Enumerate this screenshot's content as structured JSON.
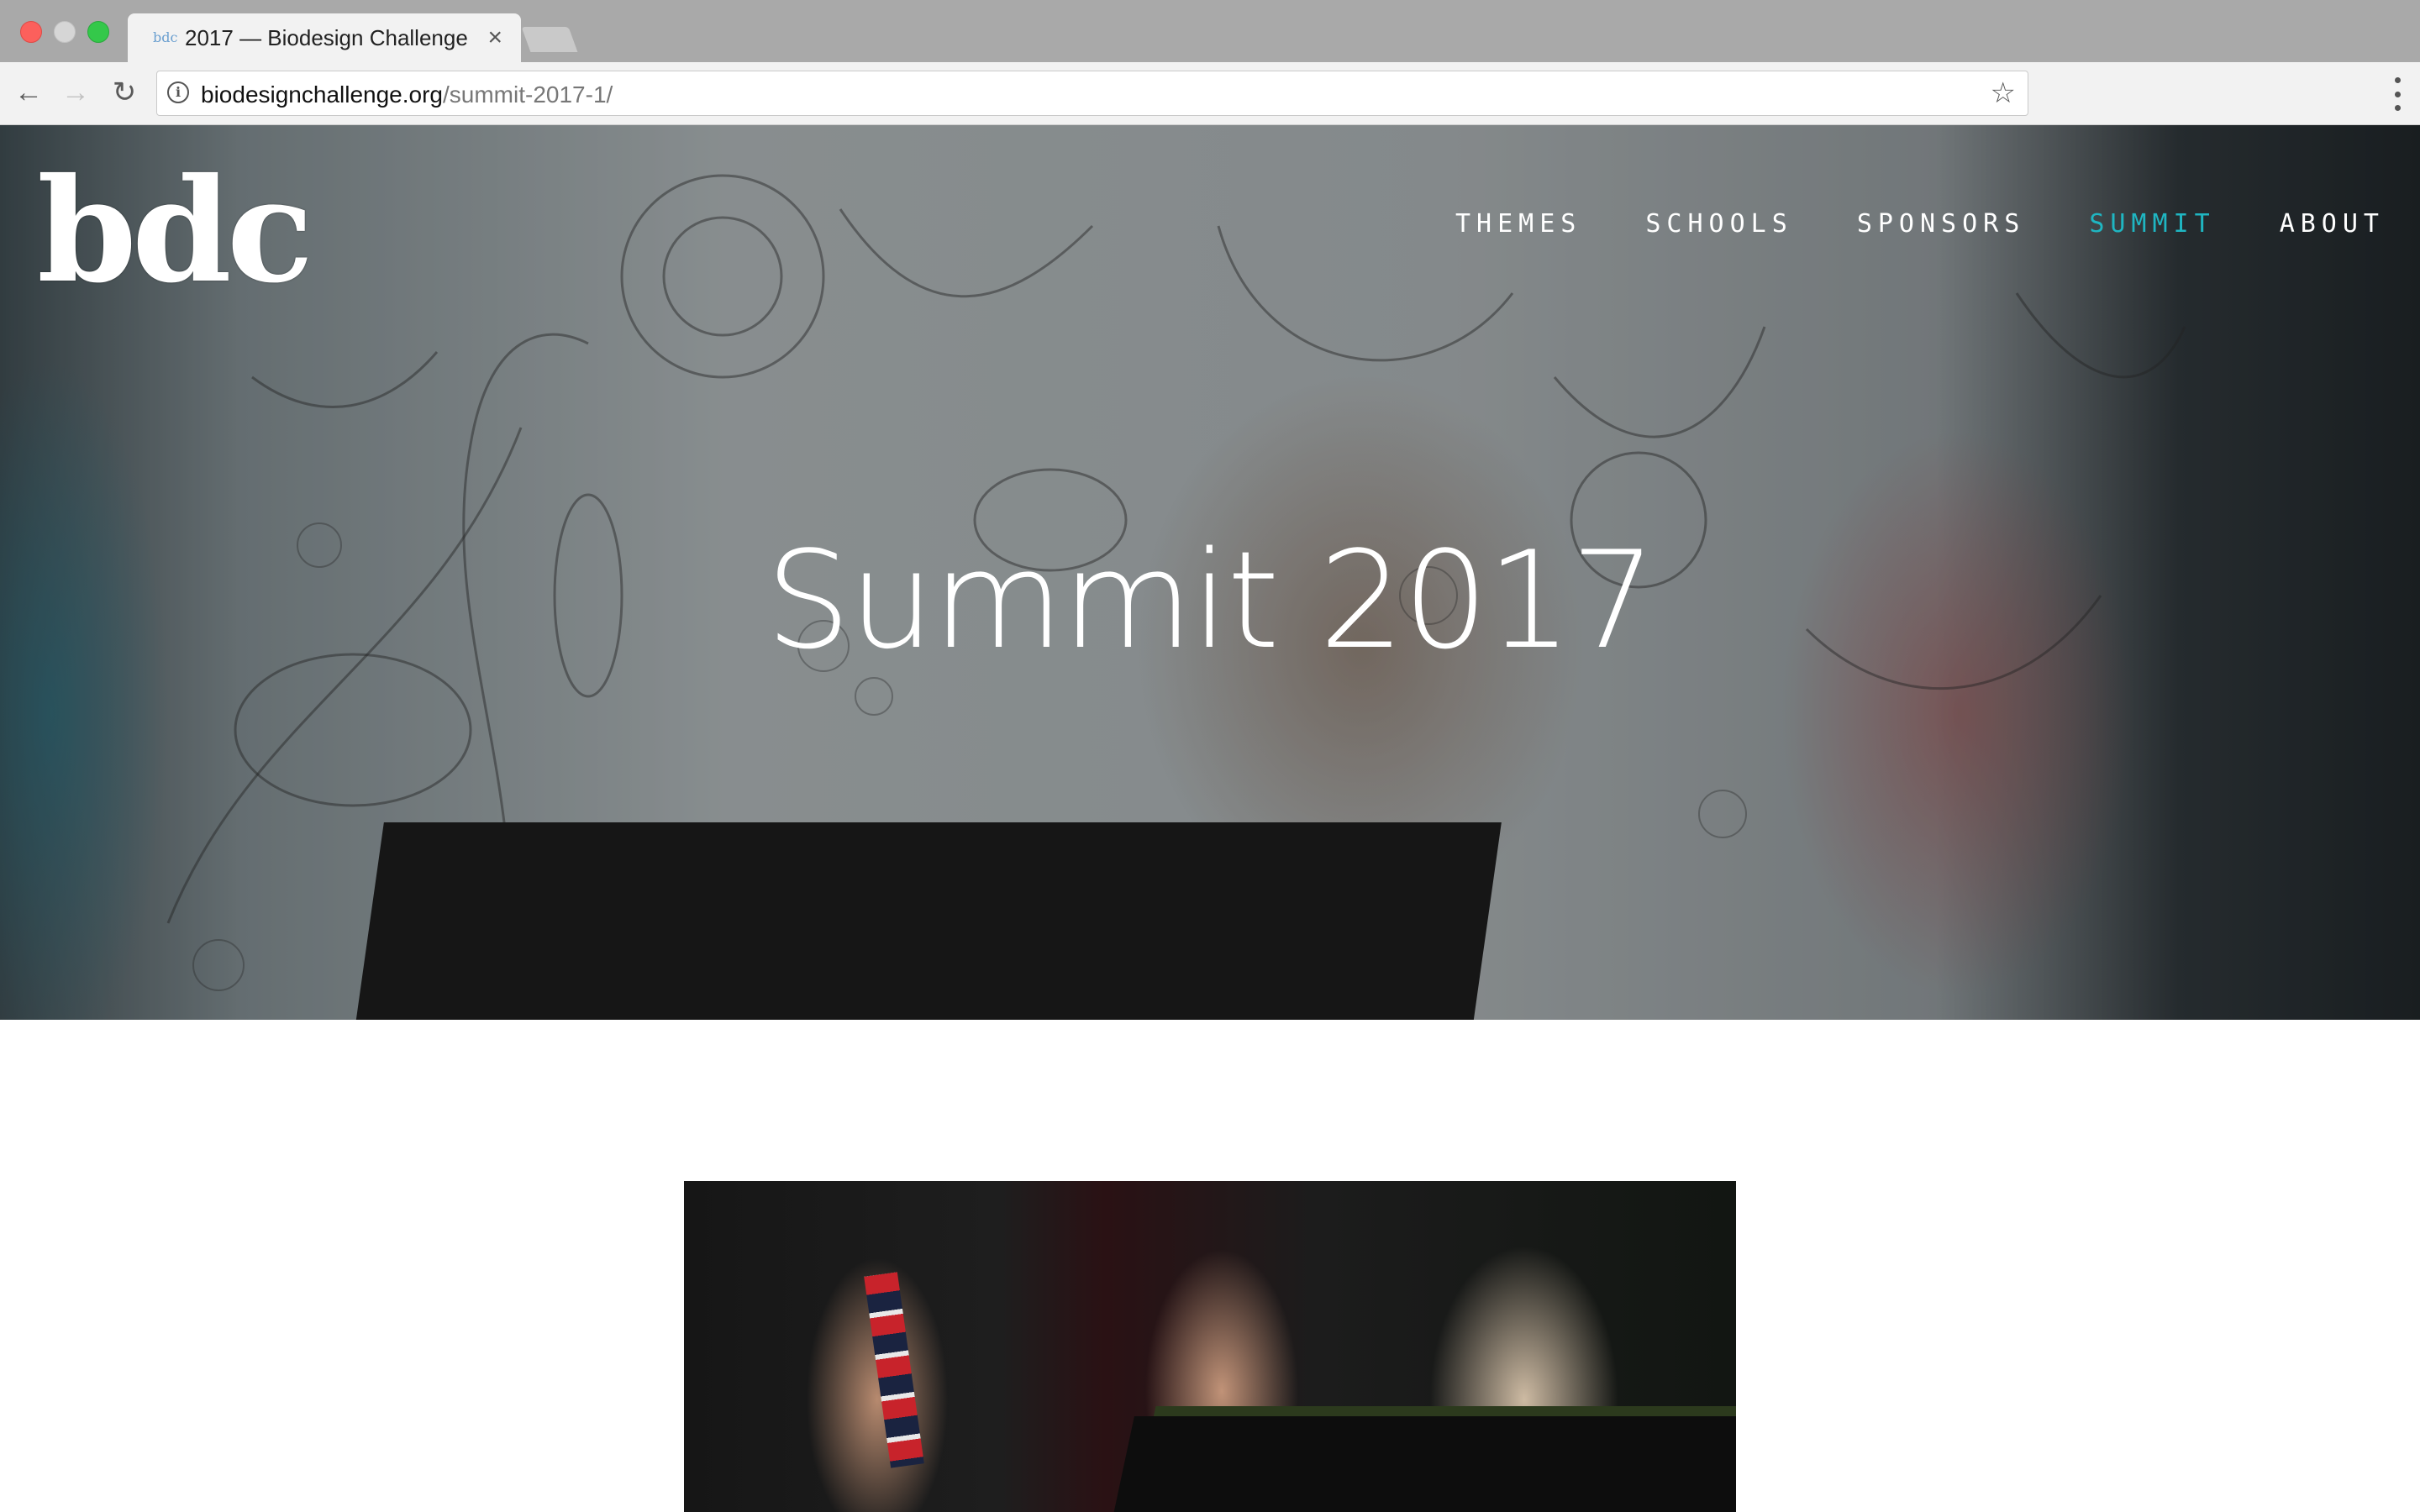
{
  "browser": {
    "tab_title": "2017 — Biodesign Challenge",
    "tab_close": "×",
    "url_host": "biodesignchallenge.org",
    "url_path": "/summit-2017-1/",
    "icons": [
      "back-icon",
      "forward-icon",
      "reload-icon",
      "info-icon",
      "star-icon",
      "menu-icon",
      "close-icon"
    ]
  },
  "site": {
    "logo_text": "bdc",
    "nav": [
      {
        "label": "THEMES",
        "active": false
      },
      {
        "label": "SCHOOLS",
        "active": false
      },
      {
        "label": "SPONSORS",
        "active": false
      },
      {
        "label": "SUMMIT",
        "active": true
      },
      {
        "label": "ABOUT",
        "active": false
      }
    ],
    "accent_color": "#1fb6c2"
  },
  "hero": {
    "title": "Summit 2017"
  }
}
